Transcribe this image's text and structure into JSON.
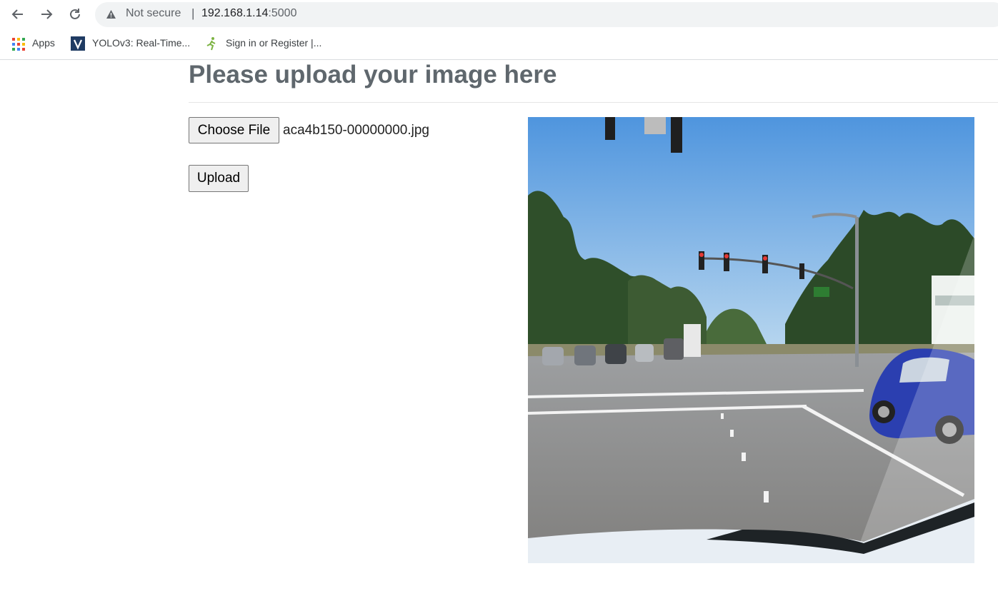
{
  "browser": {
    "security_text": "Not secure",
    "separator": "|",
    "url_host": "192.168.1.14",
    "url_port": ":5000"
  },
  "bookmarks": [
    {
      "label": "Apps",
      "icon": "apps-grid-icon"
    },
    {
      "label": "YOLOv3: Real-Time...",
      "icon": "v-logo-icon"
    },
    {
      "label": "Sign in or Register |...",
      "icon": "runner-icon"
    }
  ],
  "page": {
    "title": "Please upload your image here",
    "choose_file_label": "Choose File",
    "selected_file": "aca4b150-00000000.jpg",
    "upload_label": "Upload",
    "image_content": "street-intersection-photo"
  },
  "colors": {
    "title": "#5f676d",
    "button_bg": "#efefef",
    "omnibox_bg": "#f1f3f4"
  }
}
